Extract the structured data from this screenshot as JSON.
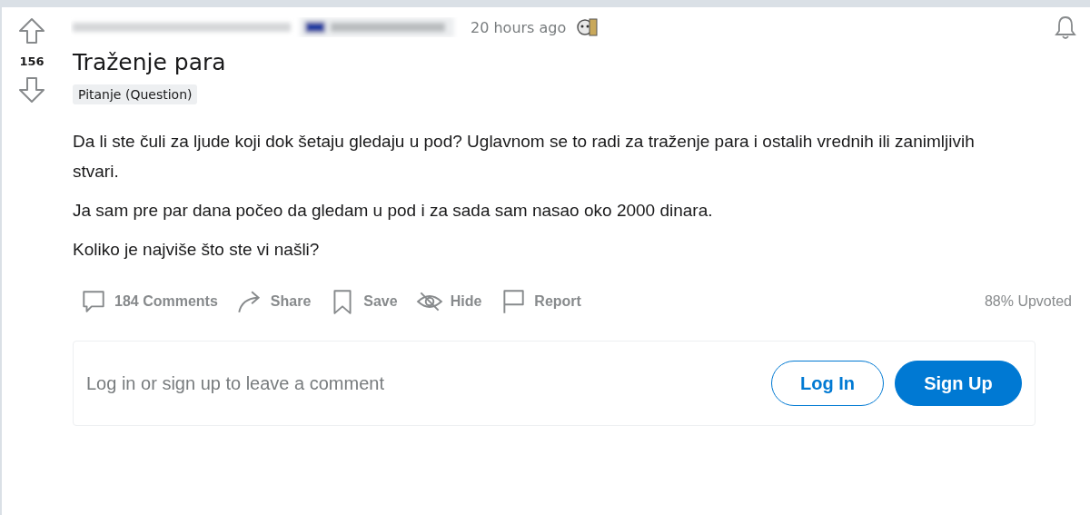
{
  "vote": {
    "score": "156"
  },
  "post": {
    "time": "20 hours ago",
    "title": "Traženje para",
    "flair": "Pitanje (Question)",
    "paragraphs": [
      "Da li ste čuli za ljude koji dok šetaju gledaju u pod? Uglavnom se to radi za traženje para i ostalih vrednih ili zanimljivih stvari.",
      "Ja sam pre par dana počeo da gledam u pod i za sada sam nasao oko 2000 dinara.",
      "Koliko je najviše što ste vi našli?"
    ]
  },
  "actions": [
    {
      "kind": "comments",
      "label": "184 Comments"
    },
    {
      "kind": "share",
      "label": "Share"
    },
    {
      "kind": "save",
      "label": "Save"
    },
    {
      "kind": "hide",
      "label": "Hide"
    },
    {
      "kind": "report",
      "label": "Report"
    }
  ],
  "upvoted": "88% Upvoted",
  "comment_box": {
    "prompt": "Log in or sign up to leave a comment",
    "buttons": [
      {
        "kind": "outline",
        "label": "Log In"
      },
      {
        "kind": "filled",
        "label": "Sign Up"
      }
    ]
  }
}
